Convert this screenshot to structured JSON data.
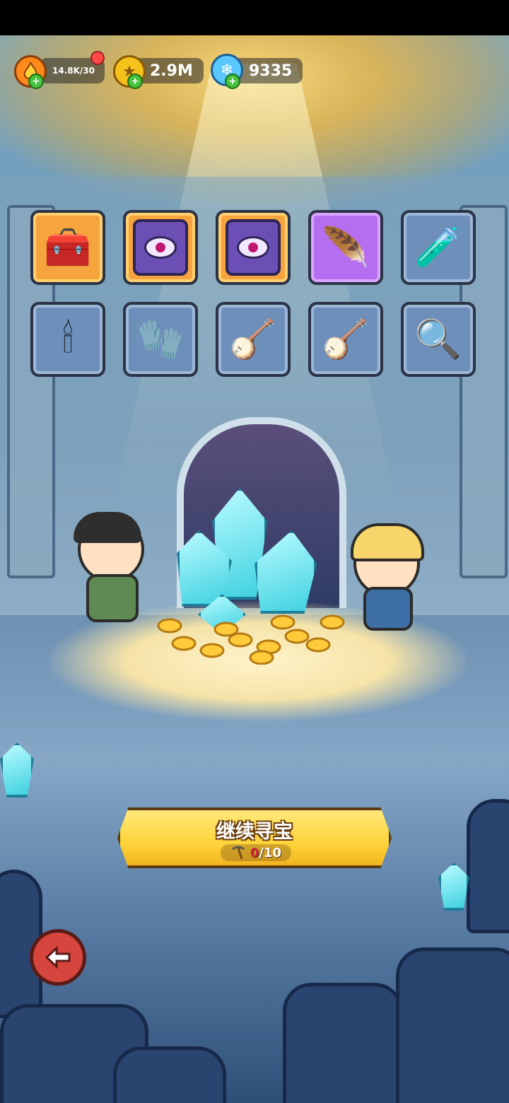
{
  "resources": {
    "energy": {
      "value": "14.8K/30",
      "icon": "flame-icon",
      "color": "#ff8a1c"
    },
    "gold": {
      "value": "2.9M",
      "icon": "coin-icon",
      "color": "#f5c21b"
    },
    "crystal": {
      "value": "9335",
      "icon": "snowflake-crystal-icon",
      "color": "#58c8ff"
    }
  },
  "items": [
    {
      "name": "treasure-chest",
      "rarity": "orange",
      "glyph": "🧰"
    },
    {
      "name": "eye-tome",
      "rarity": "orange",
      "glyph": ""
    },
    {
      "name": "eye-tome",
      "rarity": "orange",
      "glyph": ""
    },
    {
      "name": "phoenix-feather",
      "rarity": "purple",
      "glyph": "🪶"
    },
    {
      "name": "potion-vial",
      "rarity": "blue",
      "glyph": "🧪"
    },
    {
      "name": "candle",
      "rarity": "blue",
      "glyph": "🕯"
    },
    {
      "name": "leather-glove",
      "rarity": "blue",
      "glyph": "🧤"
    },
    {
      "name": "lyre",
      "rarity": "blue",
      "glyph": "🪕"
    },
    {
      "name": "lyre-crystal",
      "rarity": "blue",
      "glyph": "🪕"
    },
    {
      "name": "magnifier-amulet",
      "rarity": "blue",
      "glyph": "🔍"
    }
  ],
  "main_button": {
    "label": "继续寻宝",
    "counter_current": "0",
    "counter_total": "/10",
    "icon": "pickaxe-icon"
  },
  "back_button": {
    "icon": "back-arrow-icon"
  }
}
